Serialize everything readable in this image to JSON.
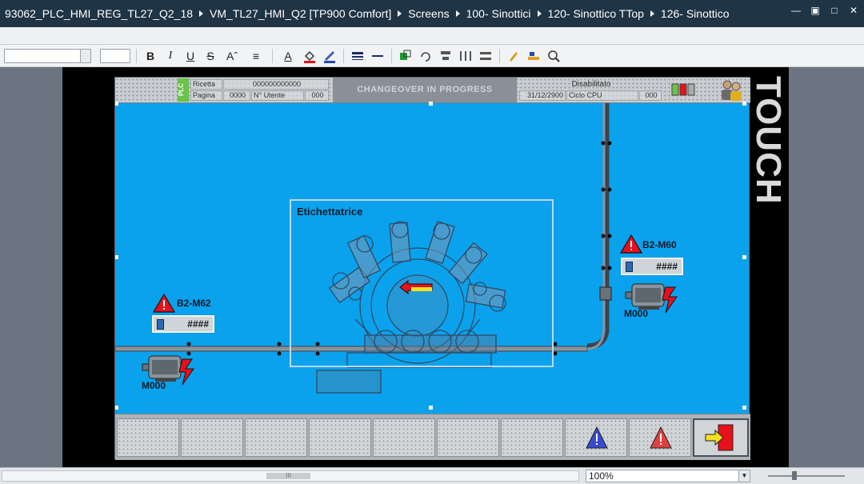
{
  "breadcrumb": [
    "93062_PLC_HMI_REG_TL27_Q2_18",
    "VM_TL27_HMI_Q2 [TP900 Comfort]",
    "Screens",
    "100- Sinottici",
    "120- Sinottico TTop",
    "126- Sinottico"
  ],
  "window_controls": {
    "minimize": "—",
    "restore": "▣",
    "maximize": "□",
    "close": "✕"
  },
  "toolbar": {
    "bold": "B",
    "italic": "I",
    "underline": "U",
    "strike": "S",
    "font_size_up": "Aˆ",
    "align": "≡",
    "font_color": "A"
  },
  "device": {
    "touch_label": "TOUCH"
  },
  "hmi_header": {
    "plc": "PLC",
    "ricetta_label": "Ricetta",
    "ricetta_value": "000000000000",
    "pagina_label": "Pagina",
    "pagina_value": "0000",
    "nr_utente_label": "N° Utente",
    "nr_utente_value": "000",
    "changeover": "CHANGEOVER IN PROGRESS",
    "status": "Disabilitato",
    "date": "31/12/2900",
    "ciclo_cpu_label": "Ciclo CPU",
    "ciclo_cpu_value": "000"
  },
  "machine": {
    "title": "Etichettatrice"
  },
  "motors": [
    {
      "label": "B2-M62",
      "value": "####",
      "motor_name": "M000"
    },
    {
      "label": "B2-M60",
      "value": "####",
      "motor_name": "M000"
    }
  ],
  "statusbar": {
    "scroll_grip": "III",
    "zoom": "100%"
  },
  "colors": {
    "screen_bg": "#0aa2ec",
    "warning_red": "#e8101a",
    "header_bg": "#1f3444"
  }
}
